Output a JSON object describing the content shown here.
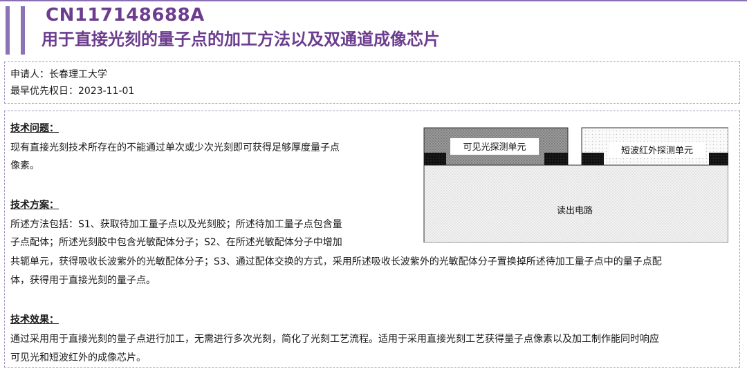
{
  "patent": {
    "number": "CN117148688A",
    "title": "用于直接光刻的量子点的加工方法以及双通道成像芯片"
  },
  "meta": {
    "applicant": "申请人：长春理工大学",
    "priority_date": "最早优先权日：2023-11-01"
  },
  "problem": {
    "heading": "技术问题：",
    "lines": [
      "现有直接光刻技术所存在的不能通过单次或少次光刻即可获得足够厚度量子点",
      "像素。"
    ]
  },
  "solution": {
    "heading": "技术方案：",
    "lines": [
      "所述方法包括：S1、获取待加工量子点以及光刻胶；所述待加工量子点包含量",
      "子点配体；所述光刻胶中包含光敏配体分子；S2、在所述光敏配体分子中增加",
      "共轭单元，获得吸收长波紫外的光敏配体分子；S3、通过配体交换的方式，采用所述吸收长波紫外的光敏配体分子置换掉所述待加工量子点中的量子点配",
      "体，获得用于直接光刻的量子点。"
    ]
  },
  "effect": {
    "heading": "技术效果：",
    "lines": [
      "通过采用用于直接光刻的量子点进行加工，无需进行多次光刻，简化了光刻工艺流程。适用于采用直接光刻工艺获得量子点像素以及加工制作能同时响应",
      "可见光和短波红外的成像芯片。"
    ]
  },
  "figure": {
    "visible_unit": "可见光探测单元",
    "swir_unit": "短波红外探测单元",
    "readout": "读出电路"
  }
}
